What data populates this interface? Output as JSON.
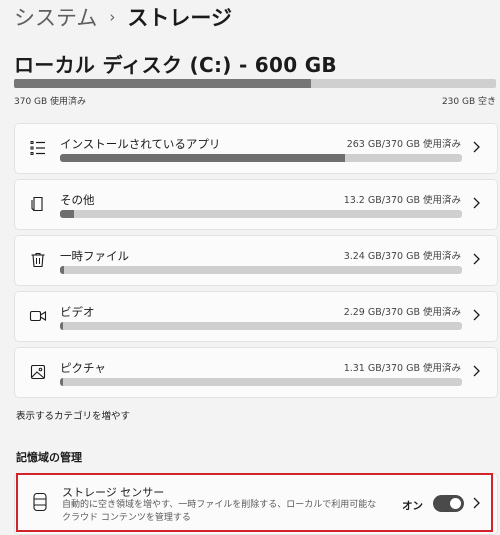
{
  "breadcrumb": {
    "parent": "システム",
    "separator": "›",
    "current": "ストレージ"
  },
  "drive": {
    "title": "ローカル ディスク (C:) - 600 GB",
    "used_label": "370 GB 使用済み",
    "free_label": "230 GB 空き",
    "used_fraction": 0.617
  },
  "categories": [
    {
      "label": "インストールされているアプリ",
      "usage": "263 GB/370 GB 使用済み",
      "icon": "apps-list-icon",
      "fraction": 0.71
    },
    {
      "label": "その他",
      "usage": "13.2 GB/370 GB 使用済み",
      "icon": "document-icon",
      "fraction": 0.036
    },
    {
      "label": "一時ファイル",
      "usage": "3.24 GB/370 GB 使用済み",
      "icon": "trash-icon",
      "fraction": 0.009
    },
    {
      "label": "ビデオ",
      "usage": "2.29 GB/370 GB 使用済み",
      "icon": "video-icon",
      "fraction": 0.006
    },
    {
      "label": "ピクチャ",
      "usage": "1.31 GB/370 GB 使用済み",
      "icon": "picture-icon",
      "fraction": 0.0035
    }
  ],
  "more_link": "表示するカテゴリを増やす",
  "section_title": "記憶域の管理",
  "storage_sense": {
    "title": "ストレージ センサー",
    "description": "自動的に空き領域を増やす、一時ファイルを削除する、ローカルで利用可能なクラウド コンテンツを管理する",
    "toggle_label": "オン",
    "toggle_on": true,
    "icon": "storage-drive-icon"
  },
  "colors": {
    "bar_fill": "#6e6e6e",
    "bar_track": "#cfcfcf",
    "highlight": "#d2232a",
    "toggle_on": "#4a4a4a"
  }
}
